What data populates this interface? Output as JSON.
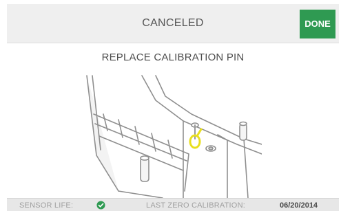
{
  "header": {
    "title": "CANCELED",
    "done_label": "DONE"
  },
  "main": {
    "instruction": "REPLACE CALIBRATION PIN"
  },
  "footer": {
    "sensor_life_label": "SENSOR LIFE:",
    "sensor_life_icon": "check-circle-icon",
    "last_zero_calibration_label": "LAST ZERO CALIBRATION:",
    "last_zero_calibration_date": "06/20/2014"
  },
  "colors": {
    "done_button": "#2f9a52",
    "sensor_ok": "#2f9a52",
    "calibration_pin": "#e8df1e"
  }
}
